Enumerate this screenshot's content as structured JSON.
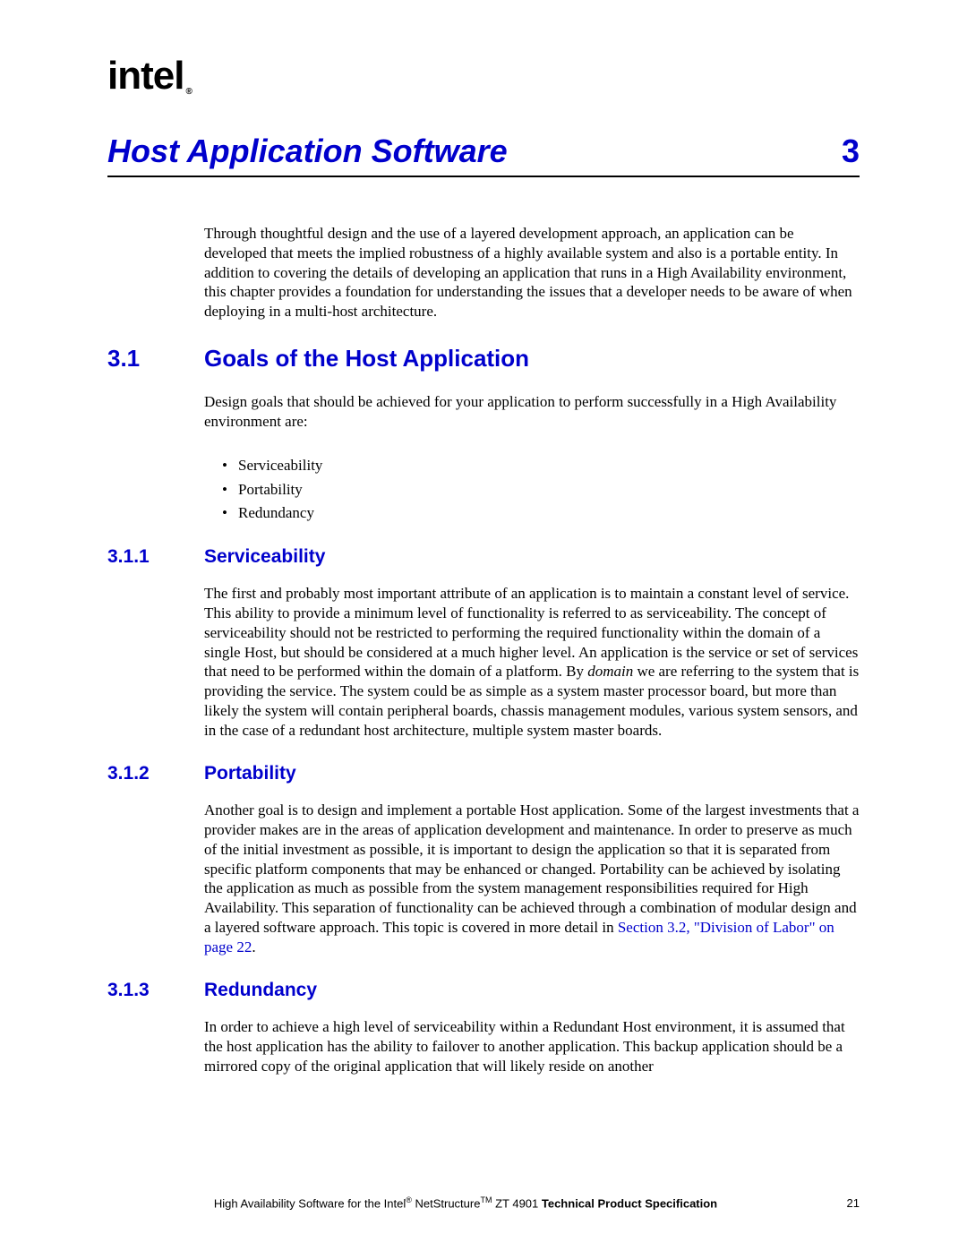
{
  "logo": {
    "text": "intel",
    "reg": "®"
  },
  "chapter": {
    "title": "Host Application Software",
    "number": "3"
  },
  "intro": "Through thoughtful design and the use of a layered development approach, an application can be developed that meets the implied robustness of a highly available system and also is a portable entity. In addition to covering the details of developing an application that runs in a High Availability environment, this chapter provides a foundation for understanding the issues that a developer needs to be aware of when deploying in a multi-host architecture.",
  "s31": {
    "num": "3.1",
    "title": "Goals of the Host Application",
    "lead": "Design goals that should be achieved for your application to perform successfully in a High Availability environment are:",
    "bullets": [
      "Serviceability",
      "Portability",
      "Redundancy"
    ]
  },
  "s311": {
    "num": "3.1.1",
    "title": "Serviceability",
    "body_a": "The first and probably most important attribute of an application is to maintain a constant level of service. This ability to provide a minimum level of functionality is referred to as serviceability. The concept of serviceability should not be restricted to performing the required functionality within the domain of a single Host, but should be considered at a much higher level. An application is the service or set of services that need to be performed within the domain of a platform. By ",
    "body_em": "domain",
    "body_b": " we are referring to the system that is providing the service. The system could be as simple as a system master processor board, but more than likely the system will contain peripheral boards, chassis management modules, various system sensors, and in the case of a redundant host architecture, multiple system master boards."
  },
  "s312": {
    "num": "3.1.2",
    "title": "Portability",
    "body_a": "Another goal is to design and implement a portable Host application. Some of the largest investments that a provider makes are in the areas of application development and maintenance. In order to preserve as much of the initial investment as possible, it is important to design the application so that it is separated from specific platform components that may be enhanced or changed. Portability can be achieved by isolating the application as much as possible from the system management responsibilities required for High Availability. This separation of functionality can be achieved through a combination of modular design and a layered software approach. This topic is covered in more detail in ",
    "link": "Section 3.2, \"Division of Labor\" on page 22",
    "body_b": "."
  },
  "s313": {
    "num": "3.1.3",
    "title": "Redundancy",
    "body": "In order to achieve a high level of serviceability within a Redundant Host environment, it is assumed that the host application has the ability to failover to another application. This backup application should be a mirrored copy of the original application that will likely reside on another"
  },
  "footer": {
    "pre": "High Availability Software for the Intel",
    "reg": "®",
    "mid": " NetStructure",
    "tm": "TM",
    "post": " ZT 4901 ",
    "bold": "Technical Product Specification",
    "page": "21"
  }
}
